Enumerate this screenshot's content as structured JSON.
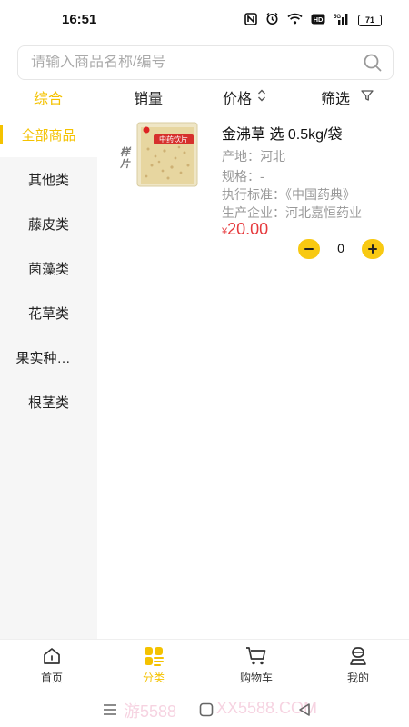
{
  "status_bar": {
    "time": "16:51",
    "battery": "71"
  },
  "search": {
    "placeholder": "请输入商品名称/编号"
  },
  "sort": {
    "items": [
      {
        "label": "综合",
        "active": true
      },
      {
        "label": "销量",
        "active": false
      },
      {
        "label": "价格",
        "active": false
      },
      {
        "label": "筛选",
        "active": false
      }
    ]
  },
  "sidebar": {
    "items": [
      {
        "label": "全部商品",
        "active": true
      },
      {
        "label": "其他类",
        "active": false
      },
      {
        "label": "藤皮类",
        "active": false
      },
      {
        "label": "菌藻类",
        "active": false
      },
      {
        "label": "花草类",
        "active": false
      },
      {
        "label": "果实种子类",
        "active": false
      },
      {
        "label": "根茎类",
        "active": false
      }
    ]
  },
  "product": {
    "title": "金沸草 选 0.5kg/袋",
    "image_badge": "样片",
    "package_label": "中药饮片",
    "origin": "产地：河北",
    "spec": "规格：-",
    "standard": "执行标准：《中国药典》",
    "maker": "生产企业：河北嘉恒药业",
    "price_currency": "¥",
    "price_value": "20.00",
    "quantity": "0"
  },
  "bottom_nav": {
    "items": [
      {
        "label": "首页",
        "icon": "home-icon",
        "active": false
      },
      {
        "label": "分类",
        "icon": "category-icon",
        "active": true
      },
      {
        "label": "购物车",
        "icon": "cart-icon",
        "active": false
      },
      {
        "label": "我的",
        "icon": "user-icon",
        "active": false
      }
    ]
  },
  "watermark": {
    "left": "游5588",
    "right": "XX5588.COM"
  },
  "colors": {
    "accent": "#f4c200",
    "price": "#e6393c",
    "sidebar_bg": "#f6f6f6",
    "muted_text": "#999999"
  }
}
